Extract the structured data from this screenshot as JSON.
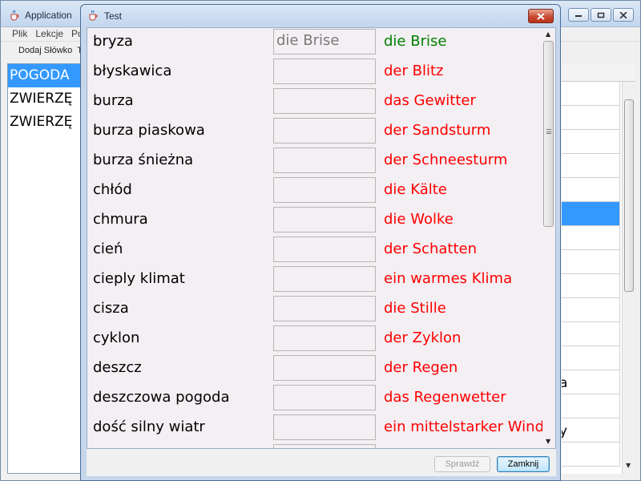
{
  "app": {
    "title": "Application",
    "menu": [
      "Plik",
      "Lekcje",
      "Po"
    ],
    "toolbar": [
      "Dodaj Słówko",
      "T"
    ],
    "lessons": [
      {
        "label": "POGODA",
        "selected": true
      },
      {
        "label": "ZWIERZĘ",
        "selected": false
      },
      {
        "label": "ZWIERZĘ",
        "selected": false
      }
    ],
    "table_rows": [
      {
        "text": "",
        "selected": false
      },
      {
        "text": "",
        "selected": false
      },
      {
        "text": "",
        "selected": false
      },
      {
        "text": "",
        "selected": false
      },
      {
        "text": "",
        "selected": false
      },
      {
        "text": "",
        "selected": true
      },
      {
        "text": "",
        "selected": false
      },
      {
        "text": "",
        "selected": false
      },
      {
        "text": "",
        "selected": false
      },
      {
        "text": "",
        "selected": false
      },
      {
        "text": "",
        "selected": false
      },
      {
        "text": "",
        "selected": false
      },
      {
        "text": "a",
        "selected": false
      },
      {
        "text": "",
        "selected": false
      },
      {
        "text": "y",
        "selected": false
      },
      {
        "text": "",
        "selected": false
      }
    ]
  },
  "dialog": {
    "title": "Test",
    "check_label": "Sprawdź",
    "close_label": "Zamknij",
    "words": [
      {
        "polish": "bryza",
        "answer": "die Brise",
        "german": "die Brise",
        "correct": true
      },
      {
        "polish": "błyskawica",
        "answer": "",
        "german": "der Blitz",
        "correct": false
      },
      {
        "polish": "burza",
        "answer": "",
        "german": "das Gewitter",
        "correct": false
      },
      {
        "polish": "burza piaskowa",
        "answer": "",
        "german": "der Sandsturm",
        "correct": false
      },
      {
        "polish": "burza śnieżna",
        "answer": "",
        "german": "der Schneesturm",
        "correct": false
      },
      {
        "polish": "chłód",
        "answer": "",
        "german": "die Kälte",
        "correct": false
      },
      {
        "polish": "chmura",
        "answer": "",
        "german": "die Wolke",
        "correct": false
      },
      {
        "polish": "cień",
        "answer": "",
        "german": "der Schatten",
        "correct": false
      },
      {
        "polish": "cieply klimat",
        "answer": "",
        "german": "ein warmes Klima",
        "correct": false
      },
      {
        "polish": "cisza",
        "answer": "",
        "german": "die Stille",
        "correct": false
      },
      {
        "polish": "cyklon",
        "answer": "",
        "german": "der Zyklon",
        "correct": false
      },
      {
        "polish": "deszcz",
        "answer": "",
        "german": "der Regen",
        "correct": false
      },
      {
        "polish": "deszczowa pogoda",
        "answer": "",
        "german": "das Regenwetter",
        "correct": false
      },
      {
        "polish": "dość silny wiatr",
        "answer": "",
        "german": "ein mittelstarker Wind",
        "correct": false
      },
      {
        "polish": "",
        "answer": "",
        "german": "",
        "correct": false
      }
    ]
  },
  "colors": {
    "correct": "#008000",
    "wrong": "#ff0000",
    "selection": "#3399ff"
  }
}
